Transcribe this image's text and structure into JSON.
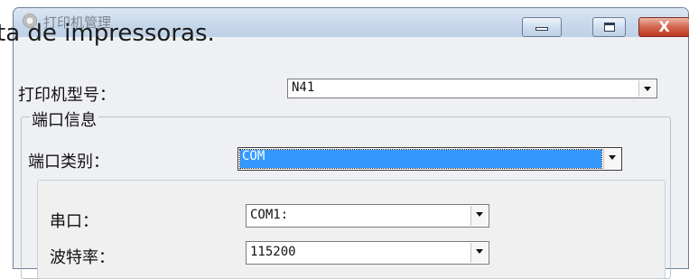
{
  "overlay_caption": "ta de impressoras.",
  "window": {
    "title": "打印机管理",
    "controls": {
      "minimize": "",
      "maximize": "",
      "close": "X"
    }
  },
  "printer_model": {
    "label": "打印机型号：",
    "value": "N41"
  },
  "port_info": {
    "group_label": "端口信息",
    "port_type": {
      "label": "端口类别：",
      "value": "COM"
    },
    "serial_port": {
      "label": "串口：",
      "value": "COM1:"
    },
    "baud_rate": {
      "label": "波特率：",
      "value": "115200"
    }
  },
  "colors": {
    "selection": "#3399ff",
    "close_button": "#c1371f",
    "window_bg": "#eef0f3"
  }
}
